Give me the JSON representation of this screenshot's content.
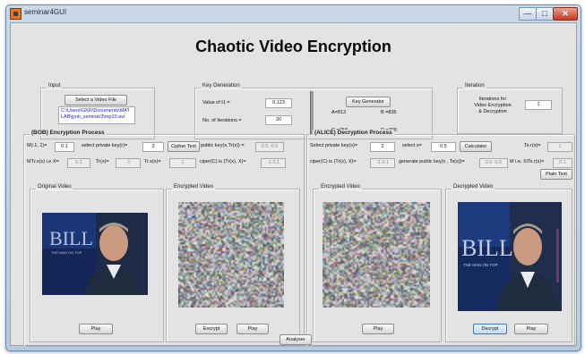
{
  "window": {
    "title": "seminar4GUI",
    "controls": {
      "minimize": "—",
      "maximize": "□",
      "close": "✕"
    }
  },
  "main_title": "Chaotic Video Encryption",
  "input": {
    "label": "Input",
    "select_button": "Select a Video File",
    "file_lines": [
      "C:\\Users\\GKR\\Documents\\MAT",
      "LAB\\jyoti_seminar3\\mp10.avi"
    ]
  },
  "keygen": {
    "label": "Key Generation",
    "t1_label": "Value of t1 =",
    "t1_value": "0.123",
    "iter_label": "No. of Iterations =",
    "iter_value": "20",
    "button": "Key Generator",
    "a": "A=813",
    "b": "B =835",
    "c": "C =758",
    "d": "D =705"
  },
  "iteration": {
    "label": "Iteration",
    "lines": [
      "Iterations for",
      "Video Encryption",
      "& Decryption"
    ],
    "value": "1"
  },
  "bob": {
    "label": "(BOB) Encryption Process",
    "m_label": "M(-1, 1)=",
    "m_value": "0.1",
    "priv_label": "select private key(r)=",
    "priv_value": "3",
    "cipher_button": "Cipher Text",
    "pub_label": "public key(x,Tr(x)) =",
    "pub_value": "0.5 -0.5",
    "mtr_label": "MTr.s(x) i.e X=",
    "mtr_value": "0.1",
    "trx_label": "Tr(x)=",
    "trx_value": "-1",
    "trsx_label": "Tr.s(x)=",
    "trsx_value": "1",
    "ciper_label": "ciper(C) is (Tr(x), X)=",
    "ciper_value": "-1 0.1",
    "original_label": "Original Video",
    "encrypted_label": "Encrypted Video",
    "play1": "Play",
    "encrypt": "Encrypt",
    "play2": "Play"
  },
  "alice": {
    "label": "(ALICE) Decryption Process",
    "priv_label": "Select private key(s)=",
    "priv_value": "2",
    "x_label": "select x=",
    "x_value": "0.5",
    "calc_button": "Calculator",
    "tsx_label": "Ts.r(x)=",
    "tsx_value": "1",
    "ciper_label": "ciper(C) is (Tr(x), X)=",
    "ciper_value": "-1 0.1",
    "gen_label": "generate public key(x , Ts(x))=",
    "gen_value": "0.5 -0.5",
    "mi_label": "M i.e, XiTs.r(x)=",
    "mi_value": "0.1",
    "plain_button": "Plain Text",
    "encrypted_label": "Encrypted Video",
    "decrypted_label": "Decrypted Video",
    "play1": "Play",
    "decrypt": "Decrypt",
    "play2": "Play"
  },
  "analyser": "Analyser",
  "video_text": {
    "big": "BILL",
    "small": "THE MAN ON TOP"
  },
  "colors": {
    "accent_blue": "#1a1ad6",
    "sky": "#1c2e66"
  }
}
